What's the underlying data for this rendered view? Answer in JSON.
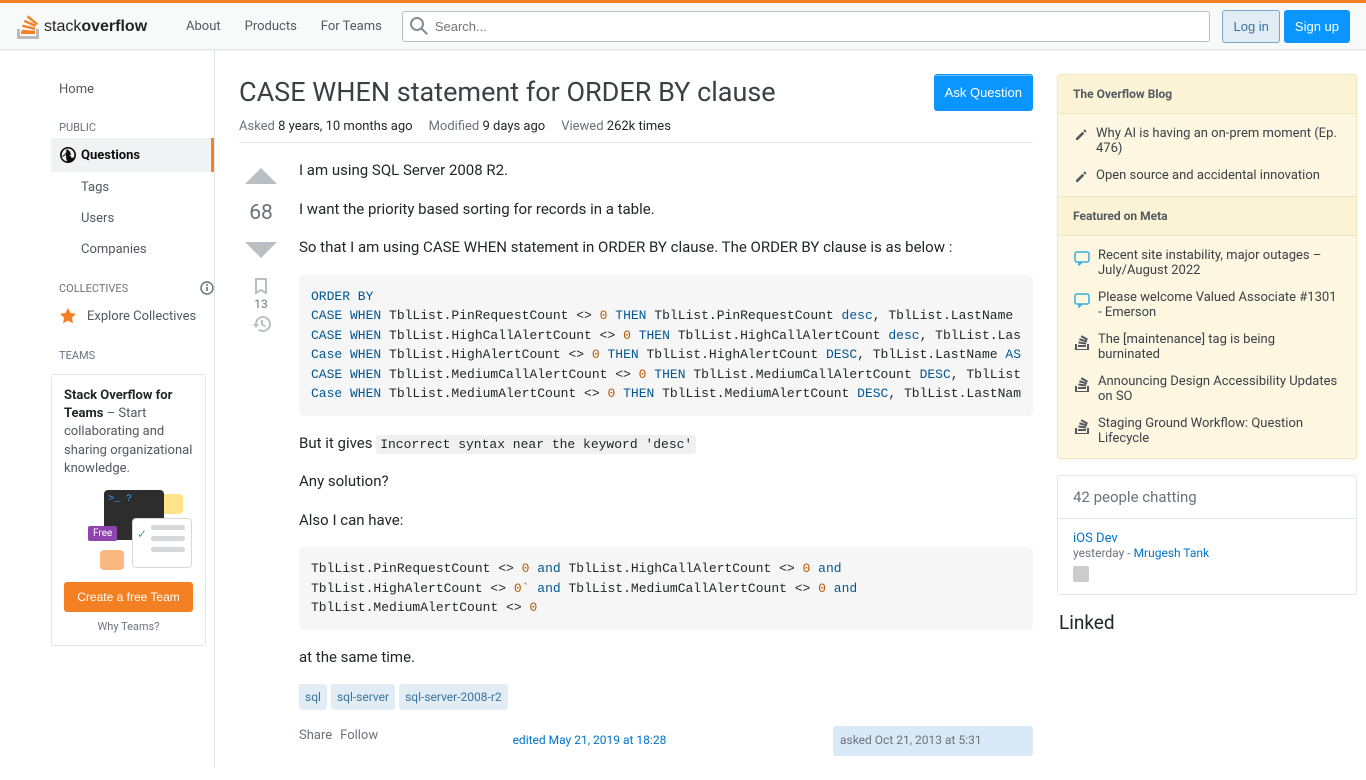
{
  "topbar": {
    "nav": {
      "about": "About",
      "products": "Products",
      "forteams": "For Teams"
    },
    "search_placeholder": "Search...",
    "login": "Log in",
    "signup": "Sign up"
  },
  "sidebar": {
    "home": "Home",
    "public": "PUBLIC",
    "questions": "Questions",
    "tags": "Tags",
    "users": "Users",
    "companies": "Companies",
    "collectives": "COLLECTIVES",
    "explore": "Explore Collectives",
    "teams": "TEAMS",
    "teams_pitch_bold": "Stack Overflow for Teams",
    "teams_pitch": " – Start collaborating and sharing organizational knowledge.",
    "create_team": "Create a free Team",
    "why_teams": "Why Teams?",
    "free_badge": "Free",
    "terminal_text": ">_ ?"
  },
  "question": {
    "title": "CASE WHEN statement for ORDER BY clause",
    "ask_btn": "Ask Question",
    "asked_label": "Asked",
    "asked": "8 years, 10 months ago",
    "modified_label": "Modified",
    "modified": "9 days ago",
    "viewed_label": "Viewed",
    "viewed": "262k times",
    "vote_count": "68",
    "bookmark_count": "13",
    "body": {
      "p1": "I am using SQL Server 2008 R2.",
      "p2": "I want the priority based sorting for records in a table.",
      "p3": "So that I am using CASE WHEN statement in ORDER BY clause. The ORDER BY clause is as below :",
      "p4_prefix": "But it gives ",
      "p4_code": "Incorrect syntax near the keyword 'desc'",
      "p5": "Any solution?",
      "p6": "Also I can have:",
      "p7": "at the same time."
    },
    "tags": [
      "sql",
      "sql-server",
      "sql-server-2008-r2"
    ],
    "actions": {
      "share": "Share",
      "follow": "Follow"
    },
    "edited": "edited May 21, 2019 at 18:28",
    "asked_info": "asked Oct 21, 2013 at 5:31"
  },
  "right": {
    "overflow_blog": "The Overflow Blog",
    "blog1": "Why AI is having an on-prem moment (Ep. 476)",
    "blog2": "Open source and accidental innovation",
    "featured": "Featured on Meta",
    "meta1": "Recent site instability, major outages – July/August 2022",
    "meta2": "Please welcome Valued Associate #1301 - Emerson",
    "meta3": "The [maintenance] tag is being burninated",
    "meta4": "Announcing Design Accessibility Updates on SO",
    "meta5": "Staging Ground Workflow: Question Lifecycle",
    "chat_header": "42 people chatting",
    "chat_room": "iOS Dev",
    "chat_time": "yesterday - ",
    "chat_user": "Mrugesh Tank",
    "linked_header": "Linked"
  }
}
